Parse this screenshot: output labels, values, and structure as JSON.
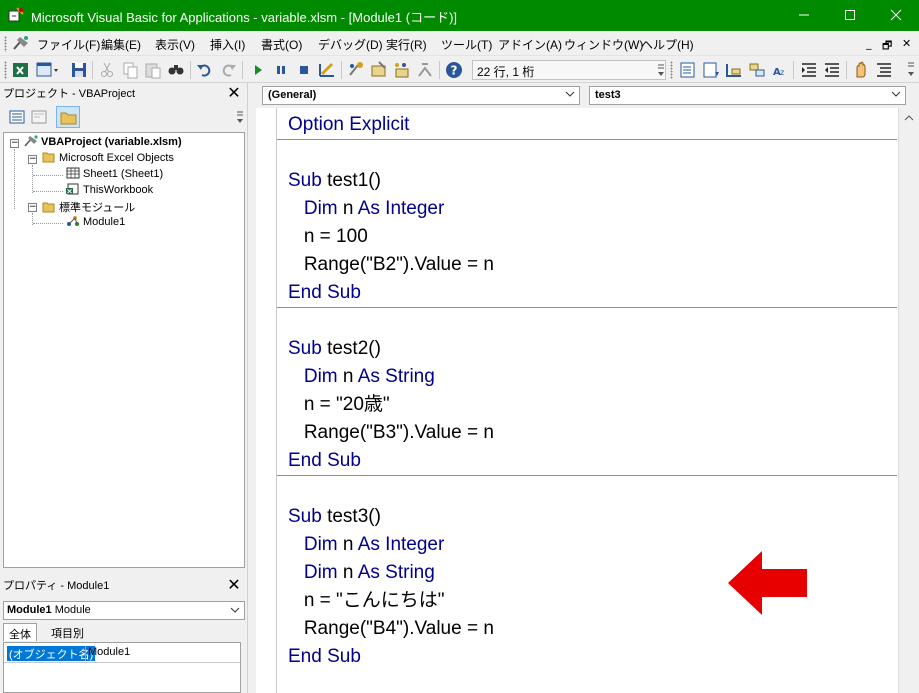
{
  "window": {
    "title": "Microsoft Visual Basic for Applications - variable.xlsm - [Module1 (コード)]",
    "title_bar_color": "#008a00"
  },
  "menu": {
    "items": [
      "ファイル(F)",
      "編集(E)",
      "表示(V)",
      "挿入(I)",
      "書式(O)",
      "デバッグ(D)",
      "実行(R)",
      "ツール(T)",
      "アドイン(A)",
      "ウィンドウ(W)",
      "ヘルプ(H)"
    ],
    "mdi_controls": [
      "_",
      "🗗",
      "✕"
    ]
  },
  "toolbar": {
    "position_text": "22 行, 1 桁"
  },
  "project_panel": {
    "title": "プロジェクト - VBAProject",
    "tree": {
      "root": "VBAProject (variable.xlsm)",
      "folder1": "Microsoft Excel Objects",
      "sheet1": "Sheet1 (Sheet1)",
      "workbook": "ThisWorkbook",
      "folder2": "標準モジュール",
      "module1": "Module1"
    }
  },
  "properties_panel": {
    "title": "プロパティ - Module1",
    "object_bold": "Module1",
    "object_type": "Module",
    "tabs": [
      "全体",
      "項目別"
    ],
    "row_name": "(オブジェクト名)",
    "row_value": "Module1"
  },
  "code_window": {
    "object_combo": "(General)",
    "procedure_combo": "test3",
    "keyword_color": "#00008b",
    "line1": "Option Explicit",
    "sub1_header": "Sub test1()",
    "sub1_dim": "   Dim n As Integer",
    "sub1_assign": "   n = 100",
    "sub1_range": "   Range(\"B2\").Value = n",
    "sub1_end": "End Sub",
    "sub2_header": "Sub test2()",
    "sub2_dim": "   Dim n As String",
    "sub2_assign": "   n = \"20歳\"",
    "sub2_range": "   Range(\"B3\").Value = n",
    "sub2_end": "End Sub",
    "sub3_header": "Sub test3()",
    "sub3_dim1": "   Dim n As Integer",
    "sub3_dim2": "   Dim n As String",
    "sub3_assign": "   n = \"こんにちは\"",
    "sub3_range": "   Range(\"B4\").Value = n",
    "sub3_end": "End Sub"
  },
  "annotation": {
    "arrow_color": "#e60000",
    "arrow_icon": "left-arrow"
  }
}
